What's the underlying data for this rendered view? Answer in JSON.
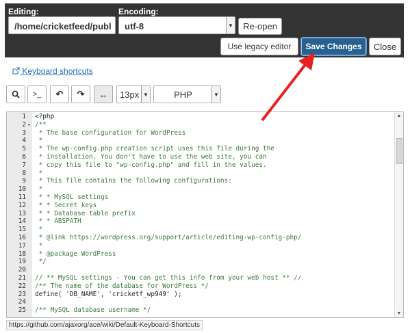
{
  "header": {
    "editing_label": "Editing:",
    "editing_value": "/home/cricketfeed/publ",
    "encoding_label": "Encoding:",
    "encoding_value": "utf-8",
    "reopen_label": "Re-open",
    "legacy_label": "Use legacy editor",
    "save_label": "Save Changes",
    "close_label": "Close"
  },
  "link": {
    "keyboard_shortcuts": "Keyboard shortcuts"
  },
  "toolbar": {
    "search": "Q",
    "goto": ">_",
    "undo": "↶",
    "redo": "↷",
    "wrap": "↔",
    "font_size": "13px",
    "mode": "PHP"
  },
  "code_lines": [
    {
      "n": "1",
      "f": "",
      "t": "<?php",
      "c": "plain"
    },
    {
      "n": "2",
      "f": "▾",
      "t": "/**",
      "c": "comment"
    },
    {
      "n": "3",
      "f": "",
      "t": " * The base configuration for WordPress",
      "c": "comment"
    },
    {
      "n": "4",
      "f": "",
      "t": " *",
      "c": "comment"
    },
    {
      "n": "5",
      "f": "",
      "t": " * The wp-config.php creation script uses this file during the",
      "c": "comment"
    },
    {
      "n": "6",
      "f": "",
      "t": " * installation. You don't have to use the web site, you can",
      "c": "comment"
    },
    {
      "n": "7",
      "f": "",
      "t": " * copy this file to \"wp-config.php\" and fill in the values.",
      "c": "comment"
    },
    {
      "n": "8",
      "f": "",
      "t": " *",
      "c": "comment"
    },
    {
      "n": "9",
      "f": "",
      "t": " * This file contains the following configurations:",
      "c": "comment"
    },
    {
      "n": "10",
      "f": "",
      "t": " *",
      "c": "comment"
    },
    {
      "n": "11",
      "f": "",
      "t": " * * MySQL settings",
      "c": "comment"
    },
    {
      "n": "12",
      "f": "",
      "t": " * * Secret keys",
      "c": "comment"
    },
    {
      "n": "13",
      "f": "",
      "t": " * * Database table prefix",
      "c": "comment"
    },
    {
      "n": "14",
      "f": "",
      "t": " * * ABSPATH",
      "c": "comment"
    },
    {
      "n": "15",
      "f": "",
      "t": " *",
      "c": "comment"
    },
    {
      "n": "16",
      "f": "",
      "t": " * @link https://wordpress.org/support/article/editing-wp-config-php/",
      "c": "comment"
    },
    {
      "n": "17",
      "f": "",
      "t": " *",
      "c": "comment"
    },
    {
      "n": "18",
      "f": "",
      "t": " * @package WordPress",
      "c": "comment"
    },
    {
      "n": "19",
      "f": "",
      "t": " */",
      "c": "comment"
    },
    {
      "n": "20",
      "f": "",
      "t": "",
      "c": "plain"
    },
    {
      "n": "21",
      "f": "",
      "t": "// ** MySQL settings - You can get this info from your web host ** //",
      "c": "comment"
    },
    {
      "n": "22",
      "f": "",
      "t": "/** The name of the database for WordPress */",
      "c": "comment"
    },
    {
      "n": "23",
      "f": "",
      "t": "define( 'DB_NAME', 'cricketf_wp949' );",
      "c": "plain"
    },
    {
      "n": "24",
      "f": "",
      "t": "",
      "c": "plain"
    },
    {
      "n": "25",
      "f": "",
      "t": "/** MySQL database username */",
      "c": "comment"
    }
  ],
  "status_url": "https://github.com/ajaxorg/ace/wiki/Default-Keyboard-Shortcuts",
  "colors": {
    "topbar": "#333333",
    "primary": "#286090",
    "annotation_arrow": "#e8211e"
  }
}
